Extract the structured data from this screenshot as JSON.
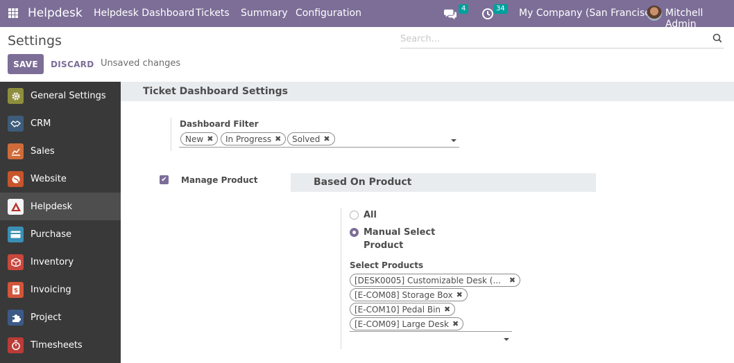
{
  "topbar": {
    "brand": "Helpdesk",
    "menu": [
      "Helpdesk Dashboard",
      "Tickets",
      "Summary",
      "Configuration"
    ],
    "messages_count": "4",
    "activities_count": "34",
    "company": "My Company (San Francisco)",
    "user": "Mitchell Admin"
  },
  "control_panel": {
    "title": "Settings",
    "search_placeholder": "Search...",
    "save_label": "SAVE",
    "discard_label": "DISCARD",
    "status": "Unsaved changes"
  },
  "sidebar": {
    "items": [
      {
        "label": "General Settings",
        "icon": "gear-icon",
        "color": "#8e8f3c"
      },
      {
        "label": "CRM",
        "icon": "handshake-icon",
        "color": "#3e5c7a"
      },
      {
        "label": "Sales",
        "icon": "chart-up-icon",
        "color": "#d06b3a"
      },
      {
        "label": "Website",
        "icon": "globe-icon",
        "color": "#c8552b"
      },
      {
        "label": "Helpdesk",
        "icon": "lifebuoy-icon",
        "color": "#b8322c"
      },
      {
        "label": "Purchase",
        "icon": "card-icon",
        "color": "#3a8fb4"
      },
      {
        "label": "Inventory",
        "icon": "box-icon",
        "color": "#c9473c"
      },
      {
        "label": "Invoicing",
        "icon": "dollar-icon",
        "color": "#d3553a"
      },
      {
        "label": "Project",
        "icon": "puzzle-icon",
        "color": "#3c5a88"
      },
      {
        "label": "Timesheets",
        "icon": "stopwatch-icon",
        "color": "#bb3b37"
      }
    ],
    "active": "Helpdesk"
  },
  "main": {
    "section_title": "Ticket Dashboard Settings",
    "dashboard_filter": {
      "label": "Dashboard Filter",
      "tags": [
        "New",
        "In Progress",
        "Solved"
      ]
    },
    "manage_product": {
      "label": "Manage Product",
      "checked": true
    },
    "based_on_product": {
      "title": "Based On Product",
      "options": [
        "All",
        "Manual Select Product"
      ],
      "selected": "Manual Select Product",
      "products_label": "Select Products",
      "products": [
        "[DESK0005] Customizable Desk (...",
        "[E-COM08] Storage Box",
        "[E-COM10] Pedal Bin",
        "[E-COM09] Large Desk"
      ]
    }
  },
  "colors": {
    "brand": "#7c6e97",
    "sidebar_bg": "#393939",
    "badge": "#00a09d"
  }
}
